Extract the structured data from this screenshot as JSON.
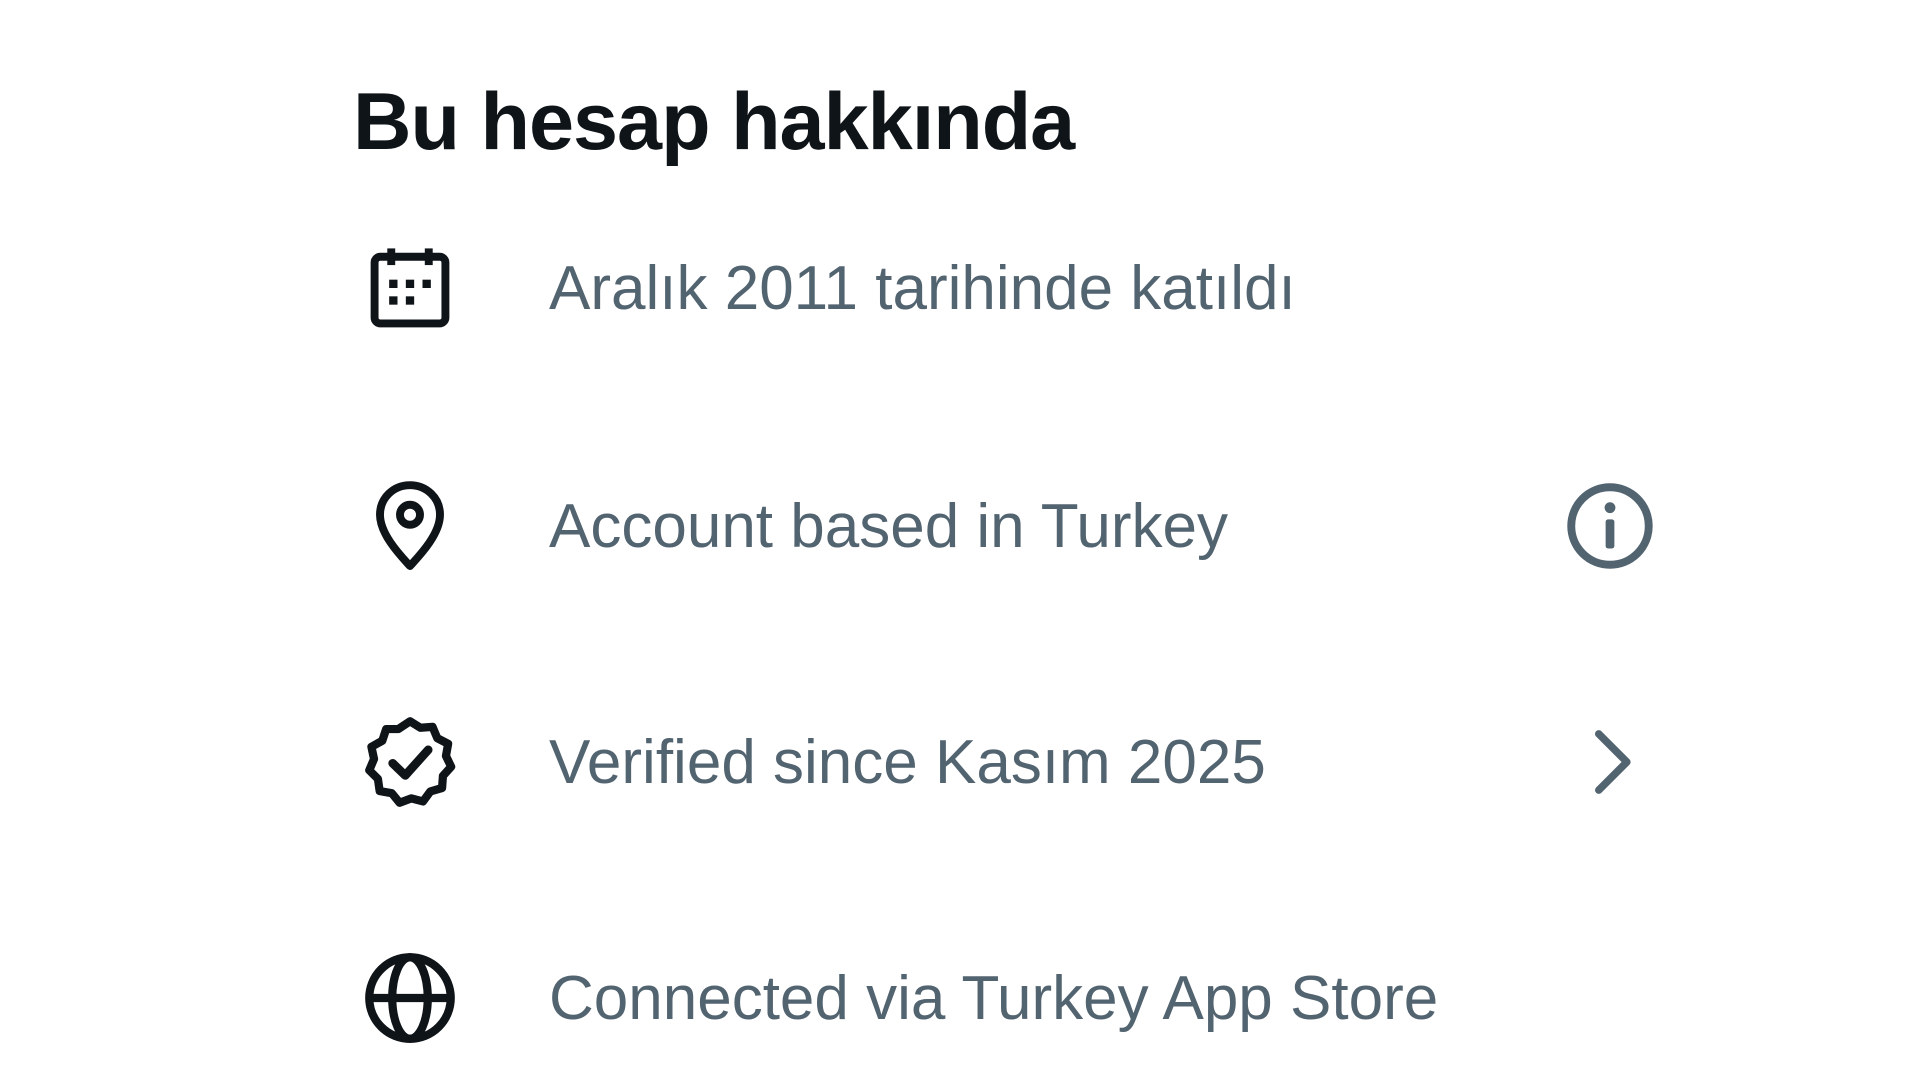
{
  "about": {
    "title": "Bu hesap hakkında",
    "rows": [
      {
        "icon": "calendar-icon",
        "text": "Aralık 2011 tarihinde katıldı",
        "action": null
      },
      {
        "icon": "location-pin-icon",
        "text": "Account based in Turkey",
        "action": "info-icon"
      },
      {
        "icon": "verified-badge-icon",
        "text": "Verified since Kasım 2025",
        "action": "chevron-right-icon"
      },
      {
        "icon": "globe-icon",
        "text": "Connected via Turkey App Store",
        "action": null
      }
    ]
  },
  "colors": {
    "heading": "#0f1419",
    "secondary_text": "#536471",
    "icon": "#0f1419",
    "action_icon": "#536471",
    "background": "#ffffff"
  }
}
